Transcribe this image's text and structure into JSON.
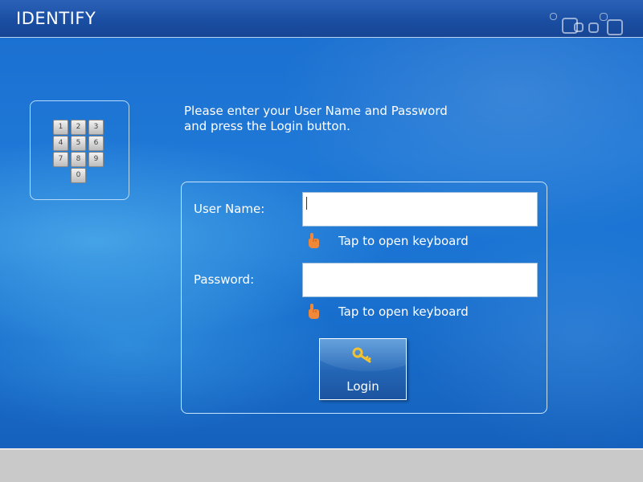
{
  "window": {
    "title": "IDENTIFY",
    "controls_icon": "window-controls-icon"
  },
  "keypad": {
    "icon": "keypad-icon",
    "keys": [
      "1",
      "2",
      "3",
      "4",
      "5",
      "6",
      "7",
      "8",
      "9",
      "0"
    ]
  },
  "instructions": {
    "line1": "Please enter your User Name and Password",
    "line2": "and press the Login button."
  },
  "login_form": {
    "username_label": "User Name:",
    "username_value": "",
    "password_label": "Password:",
    "password_value": "",
    "keyboard_hint": "Tap to open keyboard",
    "hint_icon": "pointing-hand-icon",
    "login_label": "Login",
    "login_icon": "key-icon"
  },
  "colors": {
    "title_bar": "#1a4ea2",
    "background": "#1a6ecf",
    "bottom_bar": "#c9c9c9",
    "key_icon": "#f2c230",
    "hand_icon": "#f0883a"
  }
}
